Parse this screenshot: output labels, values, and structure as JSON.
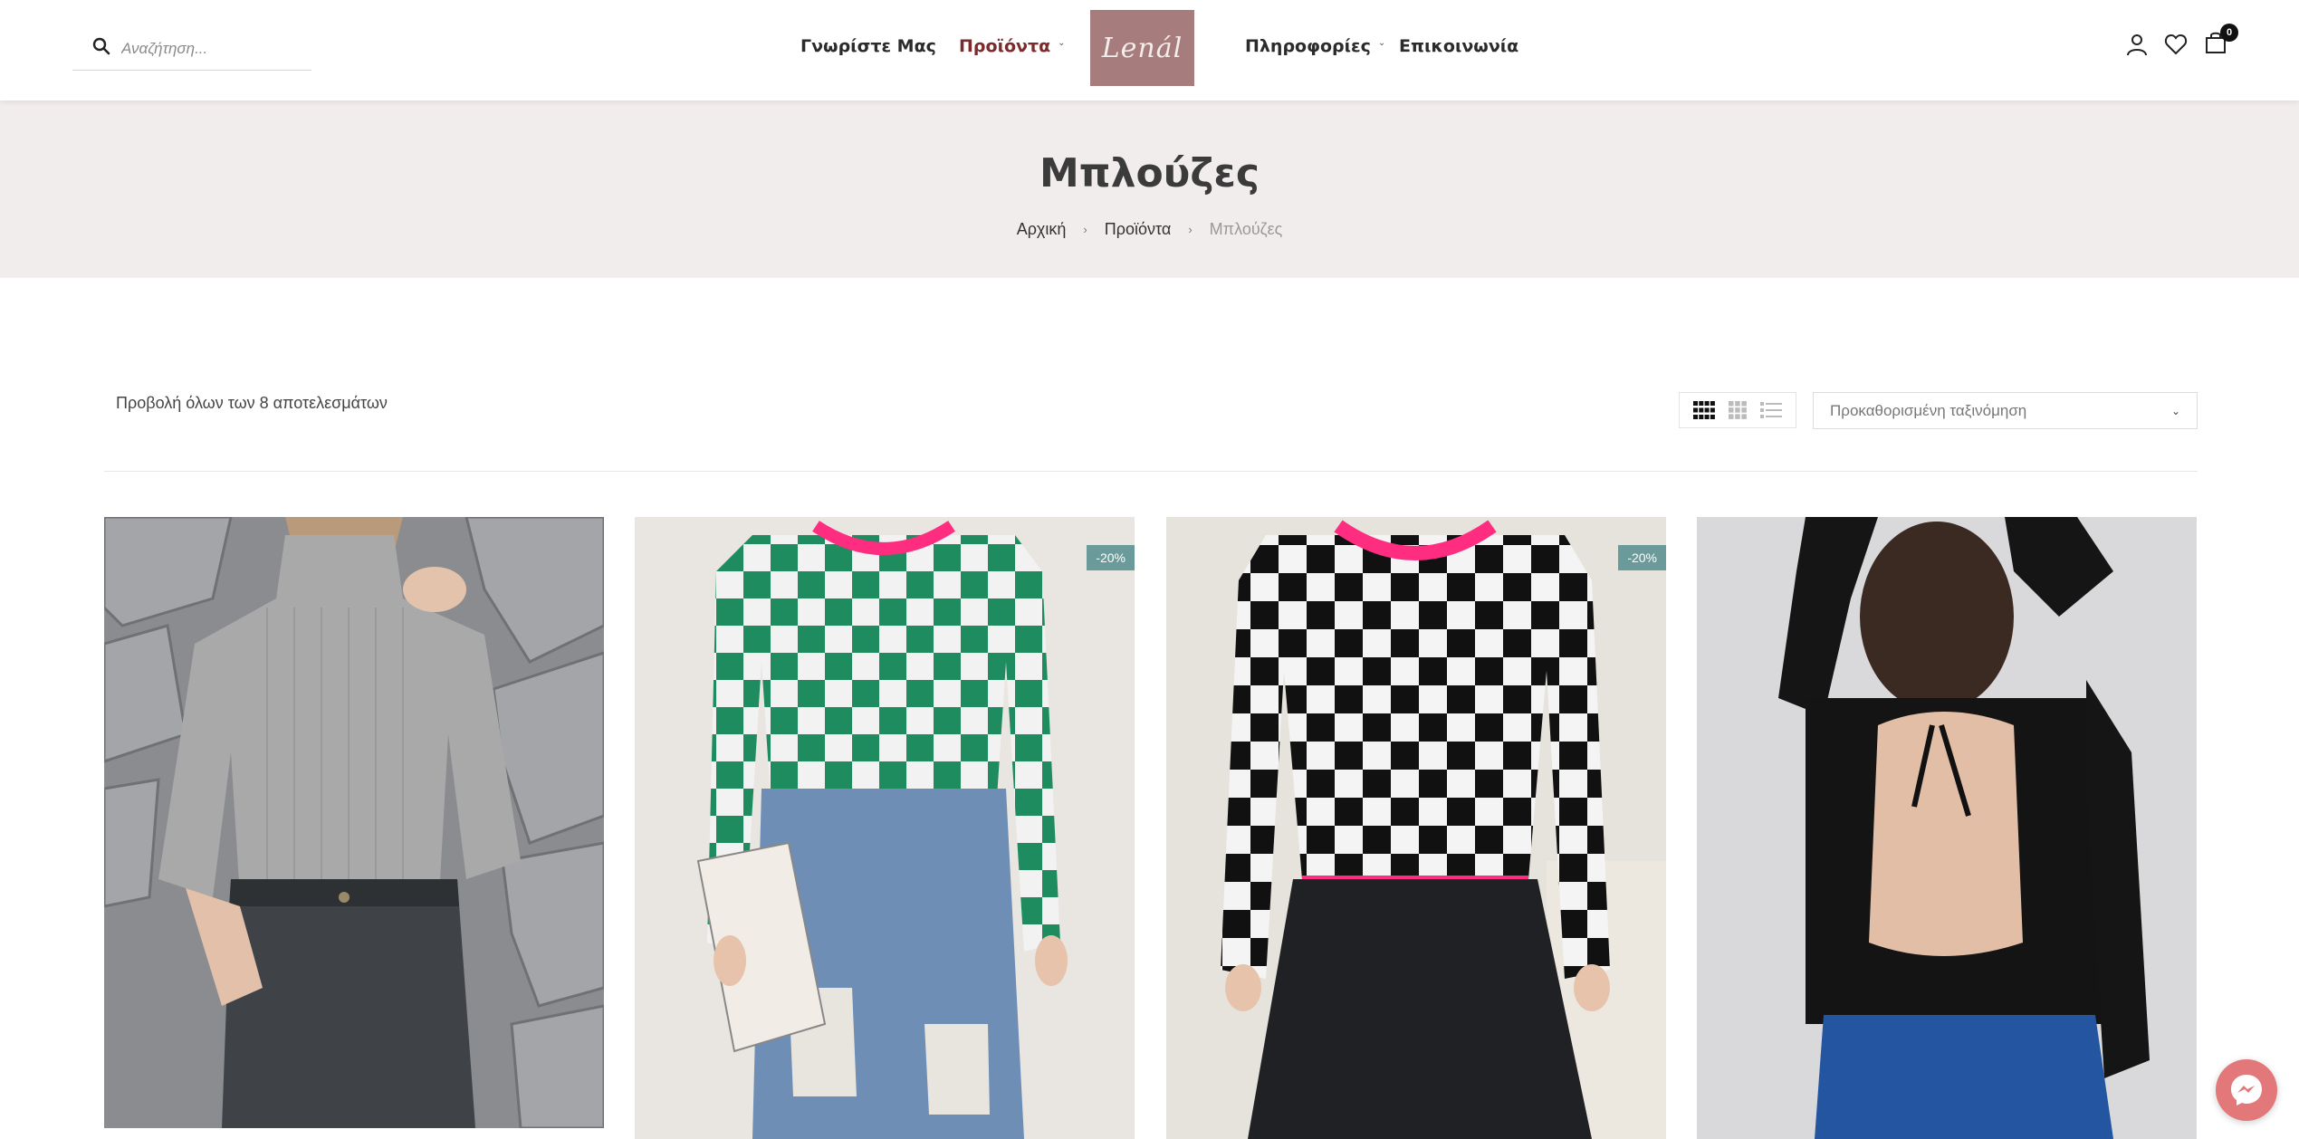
{
  "header": {
    "search": {
      "placeholder": "Αναζήτηση..."
    },
    "nav": [
      {
        "label": "Γνωρίστε Μας"
      },
      {
        "label": "Προϊόντα",
        "has_dropdown": true,
        "active": true
      },
      {
        "label": "Πληροφορίες",
        "has_dropdown": true
      },
      {
        "label": "Επικοινωνία"
      }
    ],
    "logo_text": "Lenál",
    "icons": [
      "user-icon",
      "heart-icon",
      "shopping-bag-icon"
    ],
    "cart_count": "0"
  },
  "title_band": {
    "title": "Μπλούζες",
    "breadcrumb": [
      "Αρχική",
      "Προϊόντα",
      "Μπλούζες"
    ]
  },
  "toolbar": {
    "results_text": "Προβολή όλων των 8 αποτελεσμάτων",
    "view_modes": [
      "grid-4-icon",
      "grid-3-icon",
      "list-icon"
    ],
    "sort_selected": "Προκαθορισμένη ταξινόμηση"
  },
  "products": [
    {
      "image": "grey-ribbed-turtleneck",
      "badge": ""
    },
    {
      "image": "green-checkered-knit-top",
      "badge": "-20%"
    },
    {
      "image": "black-checkered-knit-top",
      "badge": "-20%"
    },
    {
      "image": "black-open-back-top",
      "badge": ""
    }
  ],
  "colors": {
    "accent_nav": "#7b2b2b",
    "logo_bg": "#a67c7c",
    "title_band_bg": "#f2eded",
    "badge_bg": "#6a9b9a",
    "chat_bg": "#e2787a"
  }
}
